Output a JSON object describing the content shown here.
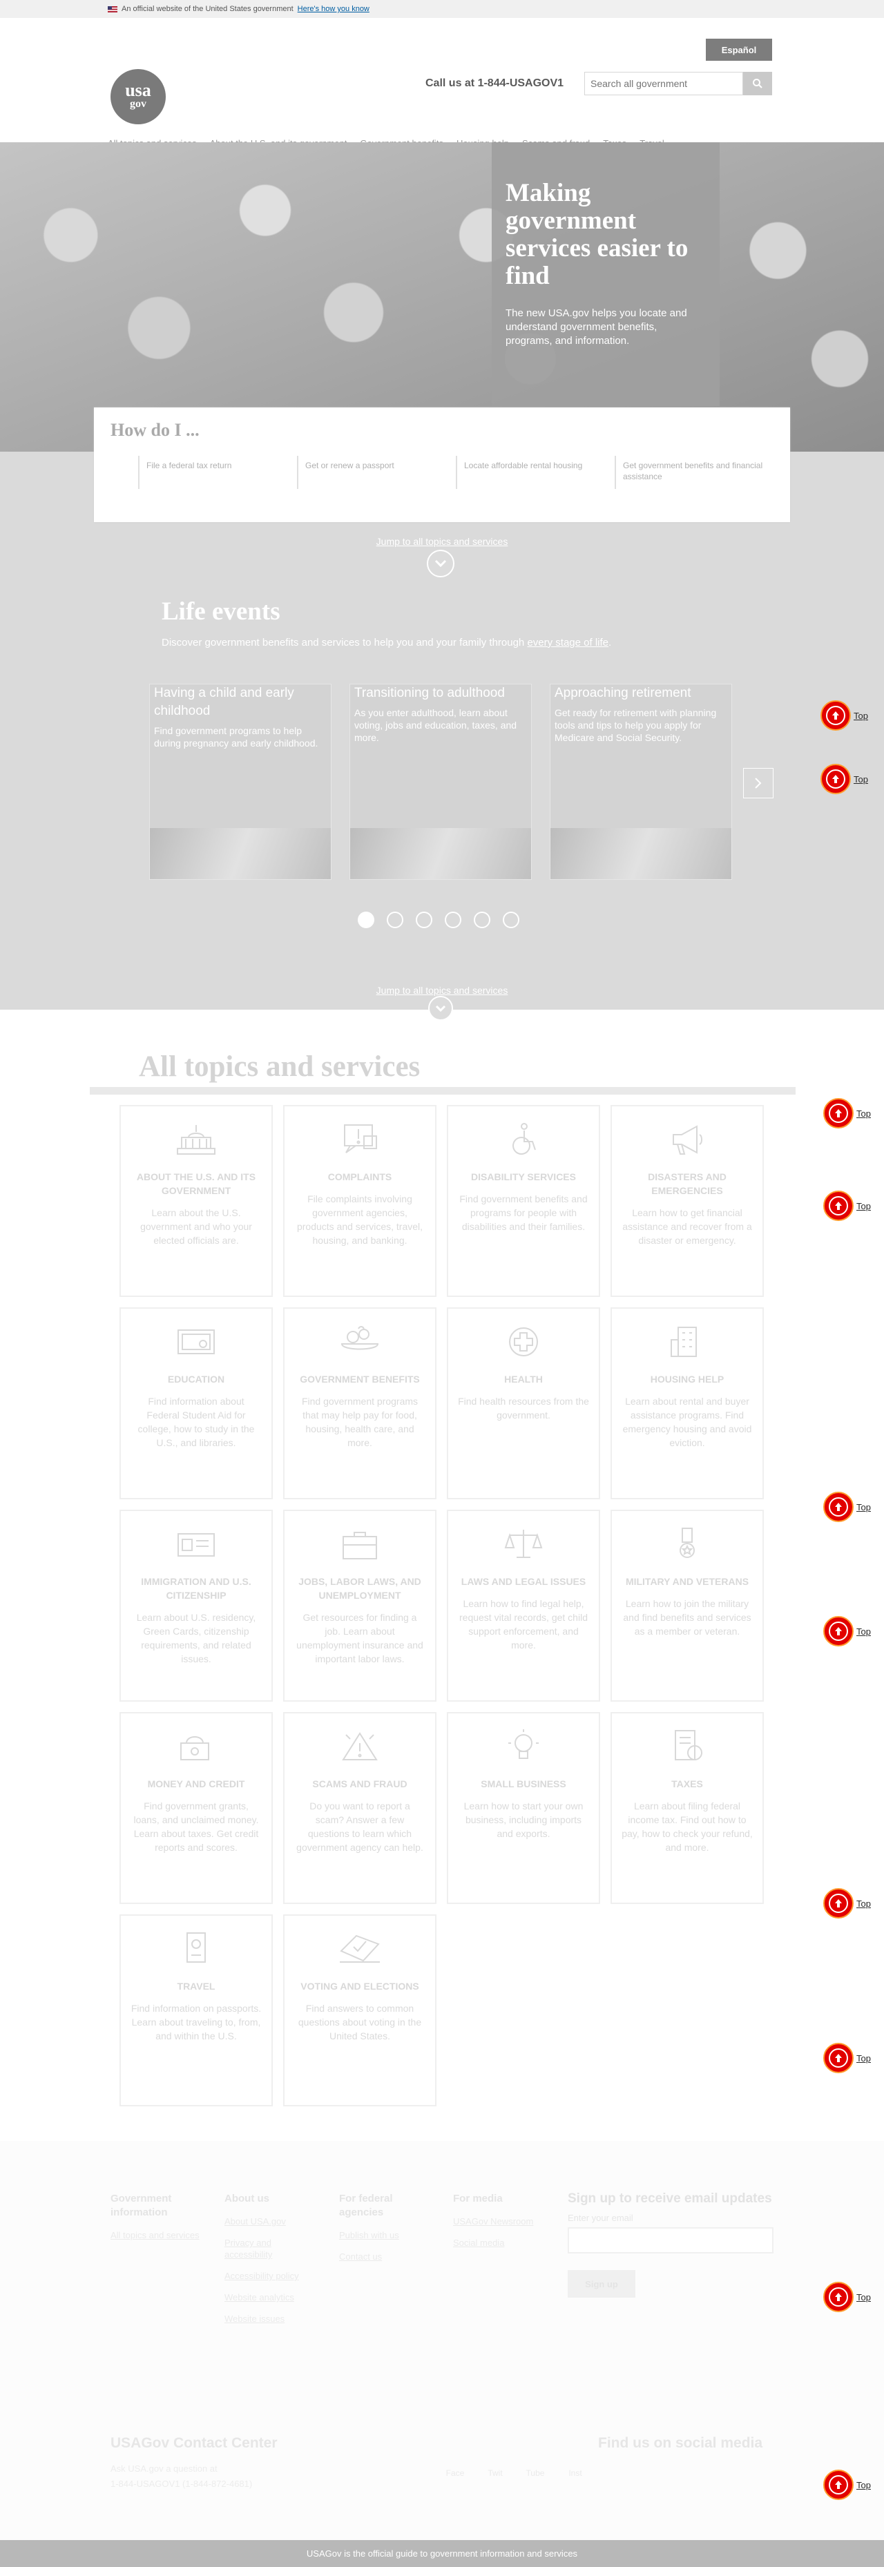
{
  "banner": {
    "text": "An official website of the United States government",
    "link": "Here's how you know"
  },
  "header": {
    "espanol": "Español",
    "logo_line1": "usa",
    "logo_line2": "gov",
    "call": "Call us at 1-844-USAGOV1",
    "search_placeholder": "Search all government",
    "nav": [
      "All topics and services",
      "About the U.S. and its government",
      "Government benefits",
      "Housing help",
      "Scams and fraud",
      "Taxes",
      "Travel"
    ]
  },
  "hero": {
    "title": "Making government services easier to find",
    "text": "The new USA.gov helps you locate and understand government benefits, programs, and information."
  },
  "howdo": {
    "title": "How do I ...",
    "links": [
      "File a federal tax return",
      "Get or renew a passport",
      "Locate affordable rental housing",
      "Get government benefits and financial assistance"
    ]
  },
  "life": {
    "jump_top": "Jump to all topics and services",
    "title": "Life events",
    "subtitle_prefix": "Discover government benefits and services to help you and your family through ",
    "subtitle_link": "every stage of life",
    "subtitle_suffix": ".",
    "cards": [
      {
        "title": "Having a child and early childhood",
        "text": "Find government programs to help during pregnancy and early childhood."
      },
      {
        "title": "Transitioning to adulthood",
        "text": "As you enter adulthood, learn about voting, jobs and education, taxes, and more."
      },
      {
        "title": "Approaching retirement",
        "text": "Get ready for retirement with planning tools and tips to help you apply for Medicare and Social Security."
      }
    ],
    "dots": 6,
    "jump_bottom": "Jump to all topics and services"
  },
  "topics": {
    "title": "All topics and services",
    "tiles": [
      {
        "icon": "capitol-icon",
        "title": "About the U.S. and its government",
        "text": "Learn about the U.S. government and who your elected officials are."
      },
      {
        "icon": "complaint-icon",
        "title": "Complaints",
        "text": "File complaints involving government agencies, products and services, travel, housing, and banking."
      },
      {
        "icon": "accessibility-icon",
        "title": "Disability services",
        "text": "Find government benefits and programs for people with disabilities and their families."
      },
      {
        "icon": "megaphone-icon",
        "title": "Disasters and emergencies",
        "text": "Learn how to get financial assistance and recover from a disaster or emergency."
      },
      {
        "icon": "diploma-icon",
        "title": "Education",
        "text": "Find information about Federal Student Aid for college, how to study in the U.S., and libraries."
      },
      {
        "icon": "food-icon",
        "title": "Government benefits",
        "text": "Find government programs that may help pay for food, housing, health care, and more."
      },
      {
        "icon": "health-icon",
        "title": "Health",
        "text": "Find health resources from the government."
      },
      {
        "icon": "building-icon",
        "title": "Housing help",
        "text": "Learn about rental and buyer assistance programs. Find emergency housing and avoid eviction."
      },
      {
        "icon": "id-card-icon",
        "title": "Immigration and U.S. citizenship",
        "text": "Learn about U.S. residency, Green Cards, citizenship requirements, and related issues."
      },
      {
        "icon": "briefcase-icon",
        "title": "Jobs, labor laws, and unemployment",
        "text": "Get resources for finding a job. Learn about unemployment insurance and important labor laws."
      },
      {
        "icon": "scales-icon",
        "title": "Laws and legal issues",
        "text": "Learn how to find legal help, request vital records, get child support enforcement, and more."
      },
      {
        "icon": "medal-icon",
        "title": "Military and veterans",
        "text": "Learn how to join the military and find benefits and services as a member or veteran."
      },
      {
        "icon": "money-icon",
        "title": "Money and credit",
        "text": "Find government grants, loans, and unclaimed money. Learn about taxes. Get credit reports and scores."
      },
      {
        "icon": "warning-icon",
        "title": "Scams and fraud",
        "text": "Do you want to report a scam? Answer a few questions to learn which government agency can help."
      },
      {
        "icon": "lightbulb-icon",
        "title": "Small business",
        "text": "Learn how to start your own business, including imports and exports."
      },
      {
        "icon": "tax-form-icon",
        "title": "Taxes",
        "text": "Learn about filing federal income tax. Find out how to pay, how to check your refund, and more."
      },
      {
        "icon": "passport-icon",
        "title": "Travel",
        "text": "Find information on passports. Learn about traveling to, from, and within the U.S."
      },
      {
        "icon": "ballot-icon",
        "title": "Voting and elections",
        "text": "Find answers to common questions about voting in the United States."
      }
    ]
  },
  "footer": {
    "columns": [
      {
        "title": "Government information",
        "links": [
          "All topics and services"
        ]
      },
      {
        "title": "About us",
        "links": [
          "About USA.gov",
          "Privacy and accessibility",
          "Accessibility policy",
          "Website analytics",
          "Website issues"
        ]
      },
      {
        "title": "For federal agencies",
        "links": [
          "Publish with us",
          "Contact us"
        ]
      },
      {
        "title": "For media",
        "links": [
          "USAGov Newsroom",
          "Social media"
        ]
      }
    ],
    "signup_title": "Sign up to receive email updates",
    "signup_label": "Enter your email",
    "signup_button": "Sign up",
    "contact_title": "USAGov Contact Center",
    "contact_line1": "Ask USA.gov a question at",
    "contact_line2": "1-844-USAGOV1 (1-844-872-4681)",
    "social_title": "Find us on social media",
    "social": [
      "Face",
      "Twit",
      "Tube",
      "Inst"
    ],
    "bottom": "USAGov is the official guide to government information and services"
  },
  "top_label": "Top",
  "colors": {
    "accent": "#e20000",
    "ring": "#ff9b2b",
    "link": "#005ea2"
  }
}
